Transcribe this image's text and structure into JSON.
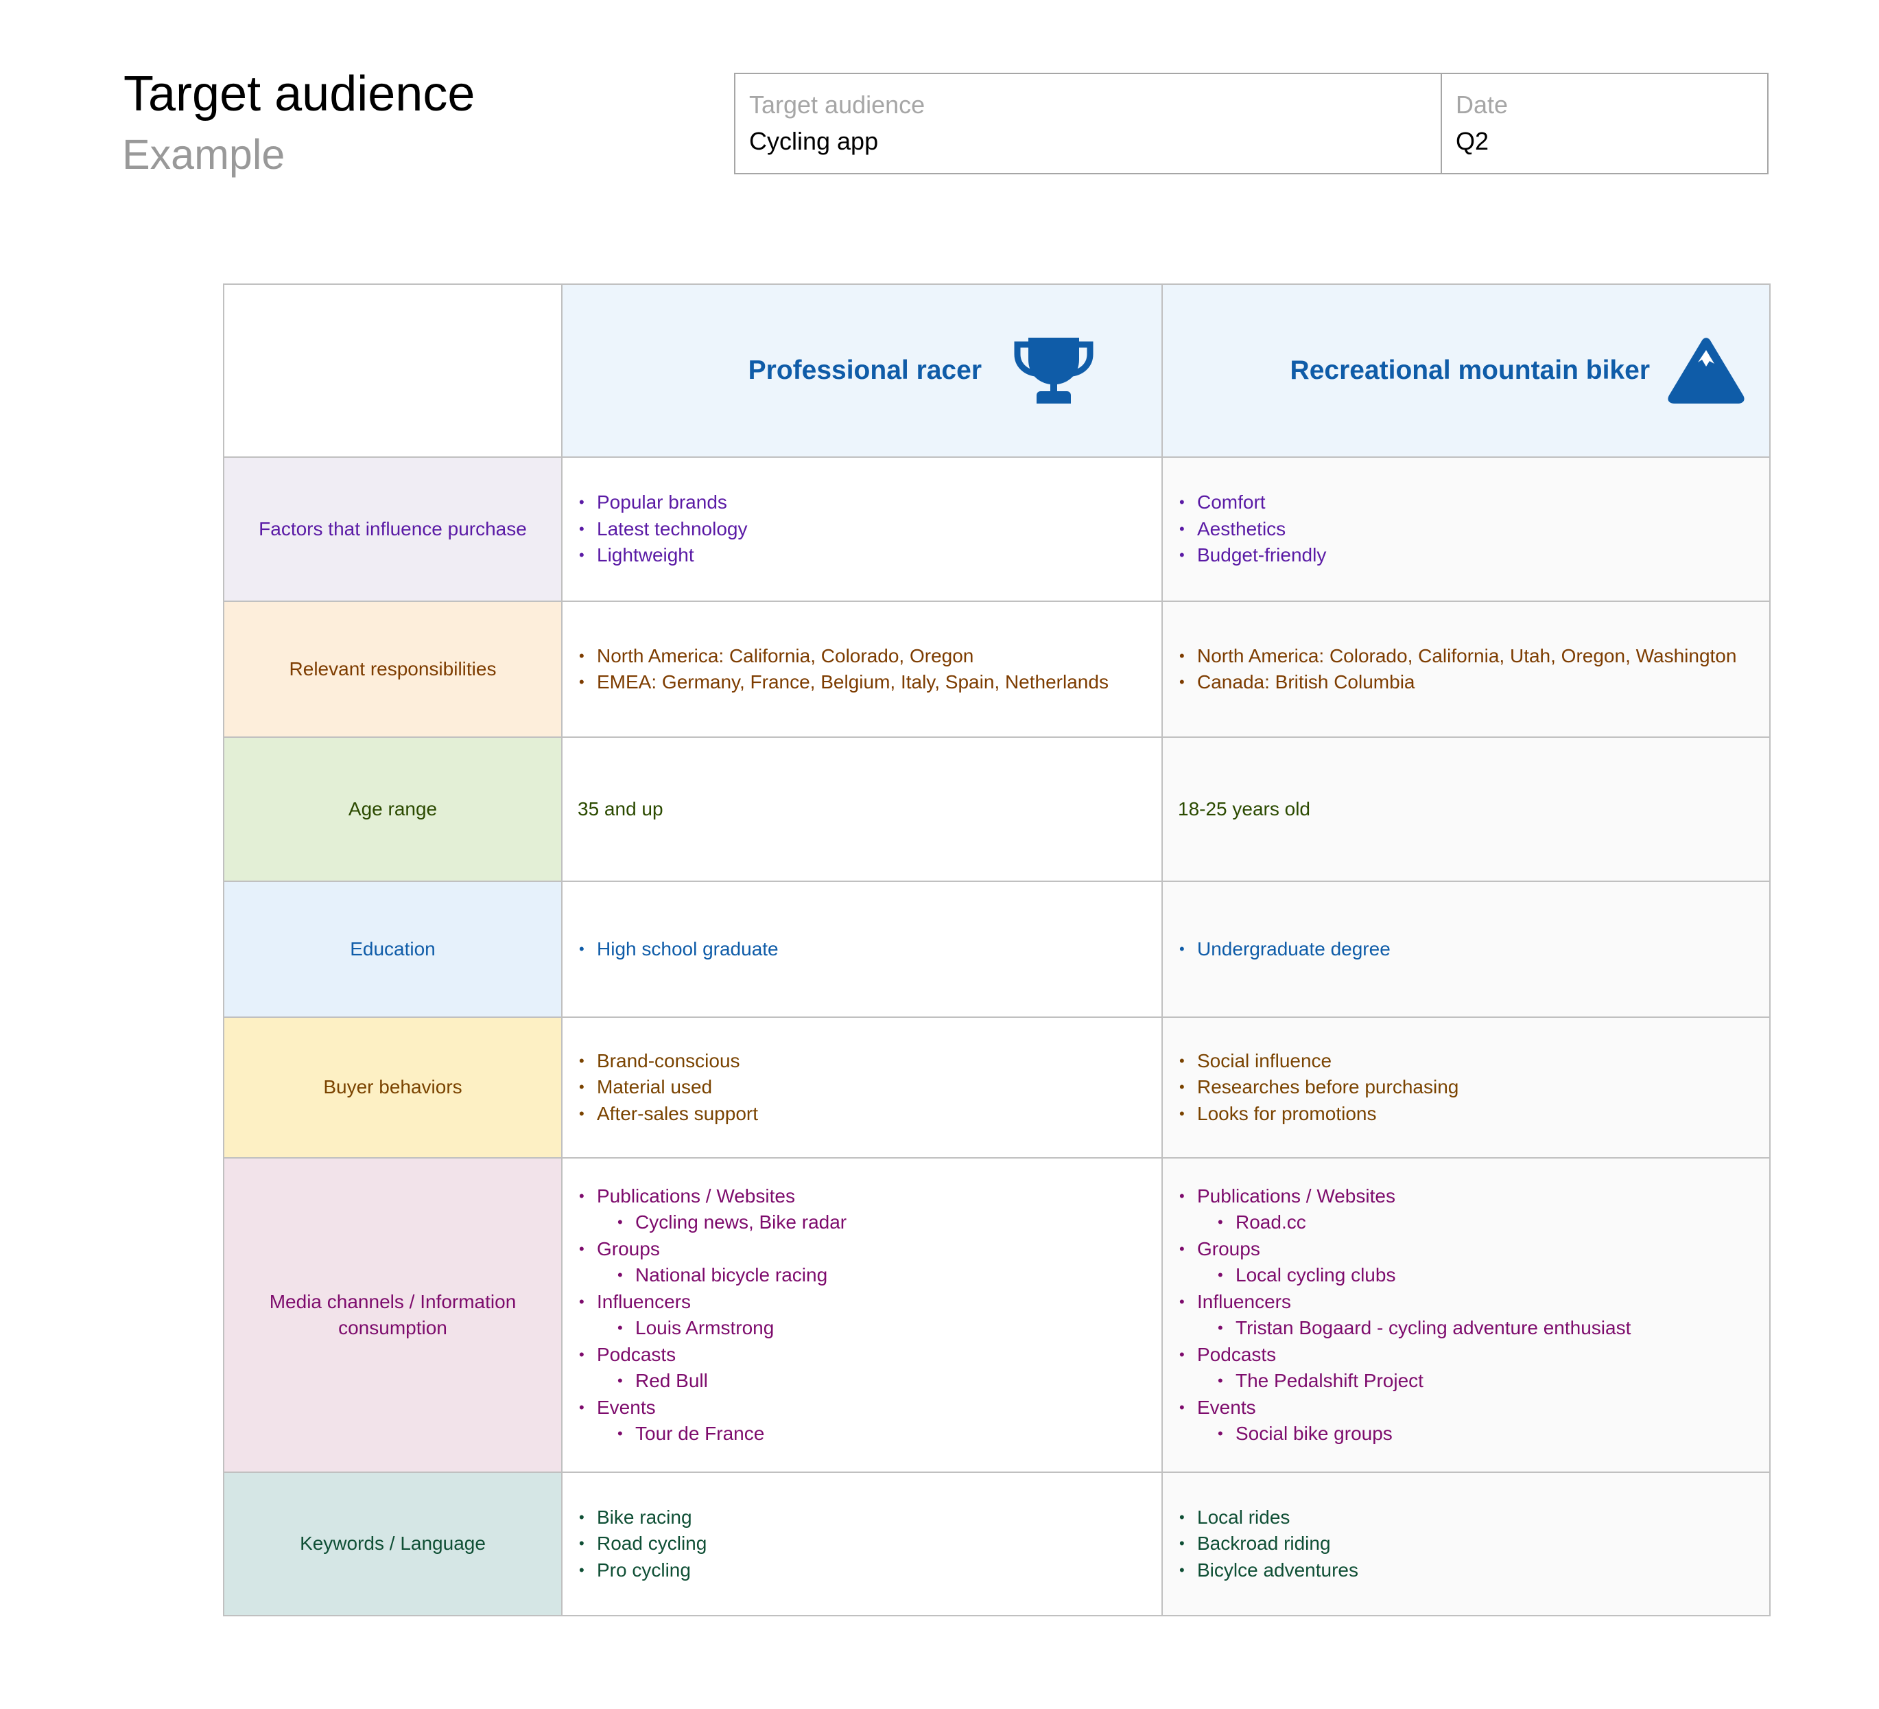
{
  "header": {
    "title": "Target audience",
    "subtitle": "Example"
  },
  "meta": {
    "audience_label": "Target audience",
    "audience_value": "Cycling app",
    "date_label": "Date",
    "date_value": "Q2"
  },
  "personas": [
    {
      "name": "Professional racer",
      "icon": "trophy-icon"
    },
    {
      "name": "Recreational mountain biker",
      "icon": "mountain-icon"
    }
  ],
  "rows": {
    "factors": {
      "label": "Factors that influence purchase",
      "col1": [
        "Popular brands",
        "Latest technology",
        "Lightweight"
      ],
      "col2": [
        "Comfort",
        "Aesthetics",
        "Budget-friendly"
      ]
    },
    "responsibilities": {
      "label": "Relevant responsibilities",
      "col1": [
        "North America: California, Colorado, Oregon",
        "EMEA: Germany, France, Belgium, Italy, Spain, Netherlands"
      ],
      "col2": [
        "North America: Colorado, California, Utah, Oregon, Washington",
        "Canada: British Columbia"
      ]
    },
    "age": {
      "label": "Age range",
      "col1": "35 and up",
      "col2": "18-25 years old"
    },
    "education": {
      "label": "Education",
      "col1": [
        "High school graduate"
      ],
      "col2": [
        "Undergraduate degree"
      ]
    },
    "buyer": {
      "label": "Buyer behaviors",
      "col1": [
        "Brand-conscious",
        "Material used",
        "After-sales support"
      ],
      "col2": [
        "Social influence",
        "Researches before purchasing",
        "Looks for promotions"
      ]
    },
    "media": {
      "label": "Media channels / Information consumption",
      "col1": [
        {
          "item": "Publications / Websites",
          "sub": "Cycling news, Bike radar"
        },
        {
          "item": "Groups",
          "sub": "National bicycle racing"
        },
        {
          "item": "Influencers",
          "sub": "Louis Armstrong"
        },
        {
          "item": "Podcasts",
          "sub": "Red Bull"
        },
        {
          "item": "Events",
          "sub": "Tour de France"
        }
      ],
      "col2": [
        {
          "item": "Publications / Websites",
          "sub": "Road.cc"
        },
        {
          "item": "Groups",
          "sub": "Local cycling clubs"
        },
        {
          "item": "Influencers",
          "sub": "Tristan Bogaard - cycling adventure enthusiast"
        },
        {
          "item": "Podcasts",
          "sub": "The Pedalshift Project"
        },
        {
          "item": "Events",
          "sub": "Social bike groups"
        }
      ]
    },
    "keywords": {
      "label": "Keywords / Language",
      "col1": [
        "Bike racing",
        "Road cycling",
        "Pro cycling"
      ],
      "col2": [
        "Local rides",
        "Backroad riding",
        "Bicylce adventures"
      ]
    }
  },
  "colors": {
    "accent": "#0f5ca8",
    "header_bg": "#edf5fc",
    "border": "#c0c0c0"
  }
}
